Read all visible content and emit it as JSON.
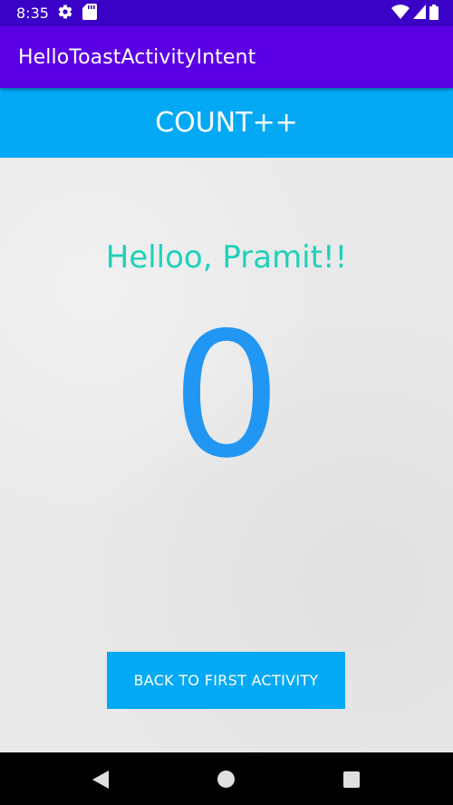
{
  "status_bar": {
    "time": "8:35",
    "icons": [
      "gear-icon",
      "sd-card-icon",
      "wifi-icon",
      "cellular-signal-icon",
      "battery-icon"
    ]
  },
  "app_bar": {
    "title": "HelloToastActivityIntent"
  },
  "main": {
    "count_button_label": "COUNT++",
    "greeting": "Helloo, Pramit!!",
    "count_value": "0",
    "back_button_label": "BACK TO FIRST ACTIVITY"
  },
  "nav_bar": {
    "icons": [
      "back-icon",
      "home-icon",
      "recents-icon"
    ]
  },
  "colors": {
    "status_bar": "#3a01c6",
    "app_bar": "#5b00e5",
    "button": "#03a9f4",
    "greeting_text": "#1fd1b8",
    "count_text": "#2196f3",
    "background": "#e9e9e9"
  }
}
